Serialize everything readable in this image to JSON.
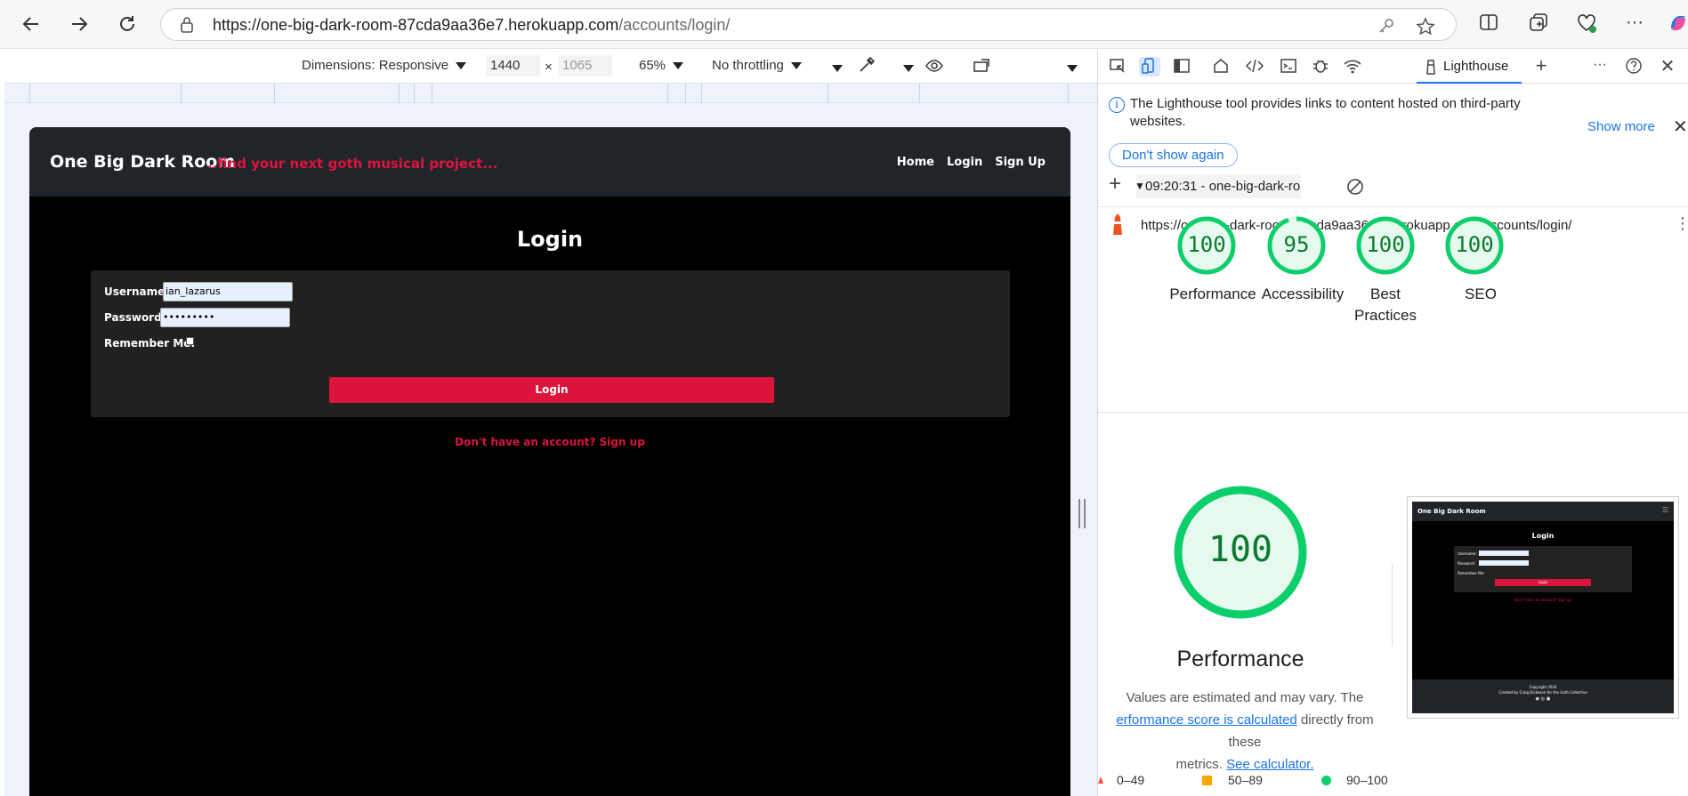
{
  "browser": {
    "url_host": "https://one-big-dark-room-87cda9aa36e7.herokuapp.com",
    "url_path": "/accounts/login/"
  },
  "device_toolbar": {
    "dimensions_label": "Dimensions: Responsive",
    "width": "1440",
    "height": "1065",
    "zoom": "65%",
    "throttling": "No throttling"
  },
  "site": {
    "brand": "One Big Dark Room",
    "tagline": "..find your next goth musical project...",
    "nav": [
      "Home",
      "Login",
      "Sign Up"
    ],
    "page_title": "Login",
    "username_label": "Username:",
    "username_value": "ian_lazarus",
    "password_label": "Password:",
    "password_value": "•••••••••",
    "remember_label": "Remember Me:",
    "login_button": "Login",
    "signup_link": "Don't have an account? Sign up"
  },
  "devtools": {
    "active_tab": "Lighthouse",
    "info_text": "The Lighthouse tool provides links to content hosted on third-party websites.",
    "show_more": "Show more",
    "dont_show_again": "Don't show again",
    "report_select": "09:20:31 - one-big-dark-room-",
    "report_url": "https://one-big-dark-room-87cda9aa36e7.herokuapp.com/accounts/login/",
    "scores": [
      {
        "score": "100",
        "label": "Performance",
        "value": 100
      },
      {
        "score": "95",
        "label": "Accessibility",
        "value": 95
      },
      {
        "score": "100",
        "label": "Best Practices",
        "value": 100
      },
      {
        "score": "100",
        "label": "SEO",
        "value": 100
      }
    ],
    "main_score": "100",
    "main_label": "Performance",
    "explain_1": "Values are estimated and may vary. The",
    "explain_link_1": "erformance score is calculated",
    "explain_2": "directly from these",
    "explain_3": "metrics.",
    "explain_link_2": "See calculator.",
    "legend": {
      "fail": "0–49",
      "average": "50–89",
      "pass": "90–100"
    },
    "thumbnail": {
      "brand": "One Big Dark Room",
      "title": "Login",
      "username_label": "Username:",
      "password_label": "Password:",
      "remember_label": "Remember Me:",
      "login_button": "Login",
      "signup_link": "Don't have an account? Sign up",
      "copyright": "Copyright 2024",
      "credit": "Created by Craig Dickeson for the Goth Collective"
    }
  },
  "colors": {
    "accent_red": "#dc143c",
    "pass_green": "#0cce6b",
    "link_blue": "#1a73e8"
  }
}
